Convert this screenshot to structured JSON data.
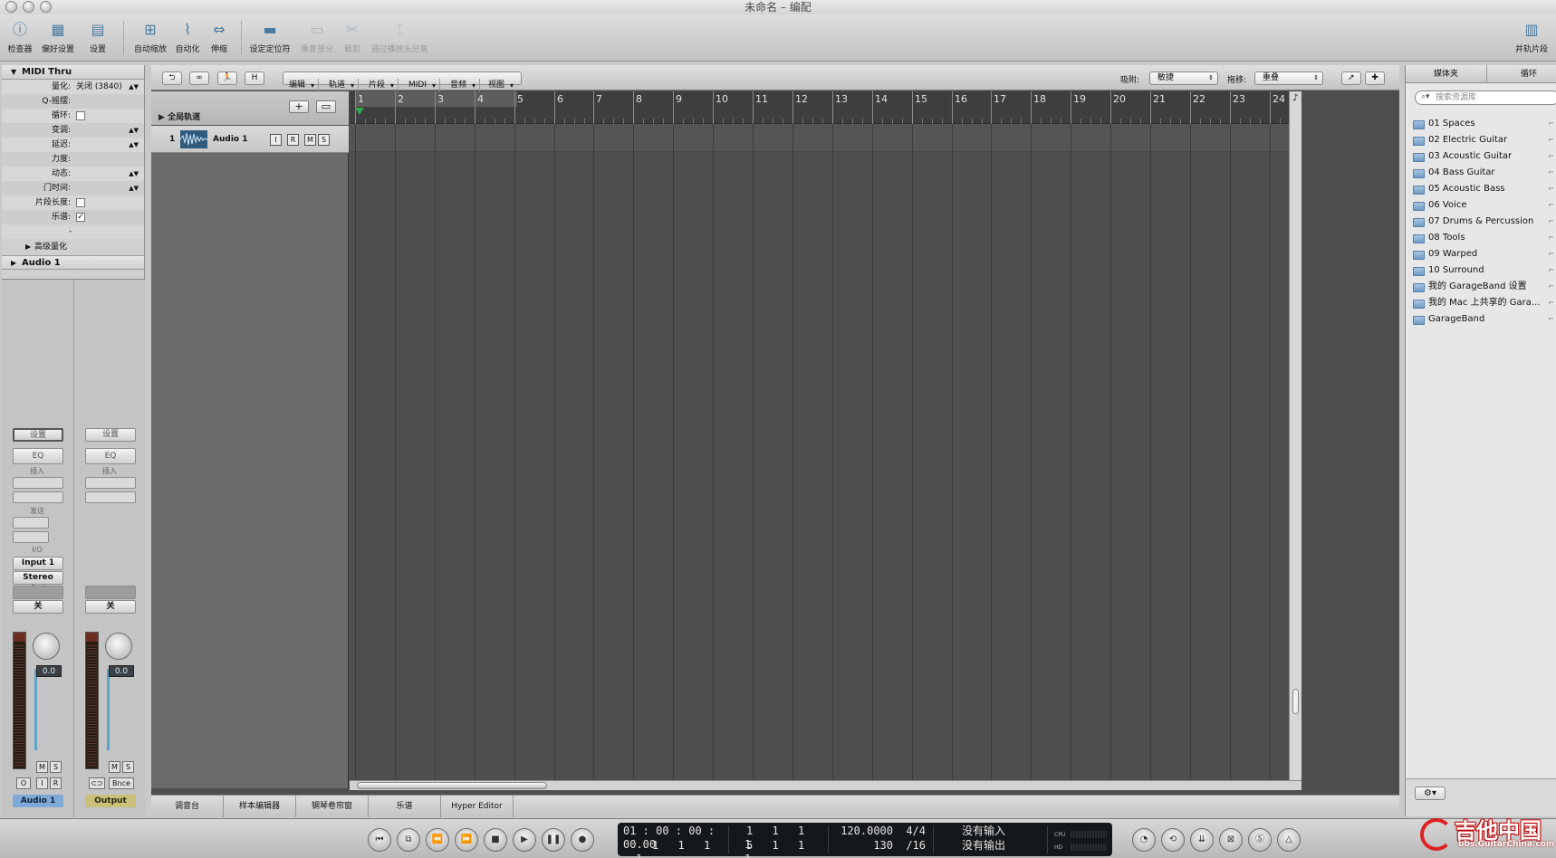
{
  "window": {
    "title": "未命名 – 编配"
  },
  "toolbar": {
    "buttons": [
      {
        "label": "检查器",
        "icon": "info-icon"
      },
      {
        "label": "偏好设置",
        "icon": "preferences-icon"
      },
      {
        "label": "设置",
        "icon": "settings-icon"
      },
      {
        "label": "自动缩放",
        "icon": "autozoom-icon"
      },
      {
        "label": "自动化",
        "icon": "automation-icon"
      },
      {
        "label": "伸缩",
        "icon": "flex-icon"
      },
      {
        "label": "设定定位符",
        "icon": "set-locators-icon"
      },
      {
        "label": "重复部分",
        "icon": "repeat-section-icon"
      },
      {
        "label": "裁剪",
        "icon": "crop-icon"
      },
      {
        "label": "通过播放头分离",
        "icon": "split-playhead-icon"
      }
    ],
    "right_label": "并轨片段"
  },
  "inspector": {
    "header": "MIDI Thru",
    "params": [
      {
        "label": "量化:",
        "value": "关闭 (3840)",
        "arrow": true
      },
      {
        "label": "Q-摇摆:",
        "value": "",
        "arrow": false
      },
      {
        "label": "循环:",
        "value": "",
        "checkbox": false
      },
      {
        "label": "变调:",
        "value": "",
        "arrow": true
      },
      {
        "label": "延迟:",
        "value": "",
        "arrow": true
      },
      {
        "label": "力度:",
        "value": "",
        "arrow": false
      },
      {
        "label": "动态:",
        "value": "",
        "arrow": true
      },
      {
        "label": "门时间:",
        "value": "",
        "arrow": true
      },
      {
        "label": "片段长度:",
        "value": "",
        "checkbox": false
      },
      {
        "label": "乐谱:",
        "value": "",
        "checkbox": true
      }
    ],
    "dash": "-",
    "advanced": "高级量化",
    "track_section": "Audio 1"
  },
  "strips": {
    "left": {
      "setting": "设置",
      "eq": "EQ",
      "insert": "插入",
      "send": "发送",
      "io": "I/O",
      "input": "Input 1",
      "output": "Stereo Out",
      "auto": "关",
      "volume": "0.0",
      "name": "Audio 1",
      "m": "M",
      "s": "S",
      "btn1": "O",
      "btn2": "I",
      "btn3": "R"
    },
    "right": {
      "setting": "设置",
      "eq": "EQ",
      "insert": "插入",
      "auto": "关",
      "volume": "0.0",
      "name": "Output",
      "m": "M",
      "s": "S",
      "btn2": "Bnce"
    }
  },
  "arrange": {
    "local_bar": {
      "menus": [
        "编辑",
        "轨道",
        "片段",
        "MIDI",
        "音频",
        "视图"
      ],
      "snap_label": "吸附:",
      "snap_value": "敏捷",
      "drag_label": "拖移:",
      "drag_value": "重叠"
    },
    "global_tracks": "全局轨道",
    "track": {
      "number": "1",
      "name": "Audio 1",
      "buttons": [
        "I",
        "R",
        "M",
        "S"
      ]
    },
    "bars": [
      "1",
      "2",
      "3",
      "4",
      "5",
      "6",
      "7",
      "8",
      "9",
      "10",
      "11",
      "12",
      "13",
      "14",
      "15",
      "16",
      "17",
      "18",
      "19",
      "20",
      "21",
      "22",
      "23",
      "24"
    ],
    "bottom_tabs": [
      "调音台",
      "样本编辑器",
      "钢琴卷帘窗",
      "乐谱",
      "Hyper Editor"
    ]
  },
  "media": {
    "tabs": [
      "媒体夹",
      "循环"
    ],
    "search_placeholder": "搜索资源库",
    "folders": [
      "01 Spaces",
      "02 Electric Guitar",
      "03 Acoustic Guitar",
      "04 Bass Guitar",
      "05 Acoustic Bass",
      "06 Voice",
      "07 Drums & Percussion",
      "08 Tools",
      "09 Warped",
      "10 Surround",
      "我的 GarageBand 设置",
      "我的 Mac 上共享的 Gara...",
      "GarageBand"
    ]
  },
  "transport": {
    "smpte": "01 : 00 : 00 : 00.00",
    "pos_top": [
      "1",
      "1",
      "1",
      "1"
    ],
    "pos_bottom": [
      "1",
      "1",
      "1",
      "1"
    ],
    "len_top": [
      "1",
      "1",
      "1",
      "1"
    ],
    "len_bottom": [
      "5",
      "1",
      "1",
      "1"
    ],
    "tempo": "120.0000",
    "tempo_bottom": "130",
    "sig_top": "4/4",
    "sig_bottom": "/16",
    "in_status": "没有输入",
    "out_status": "没有输出",
    "cpu_label": "CPU",
    "hd_label": "HD"
  },
  "watermark": {
    "big": "吉他中国",
    "small": "bbs.GuitarChina.com"
  }
}
